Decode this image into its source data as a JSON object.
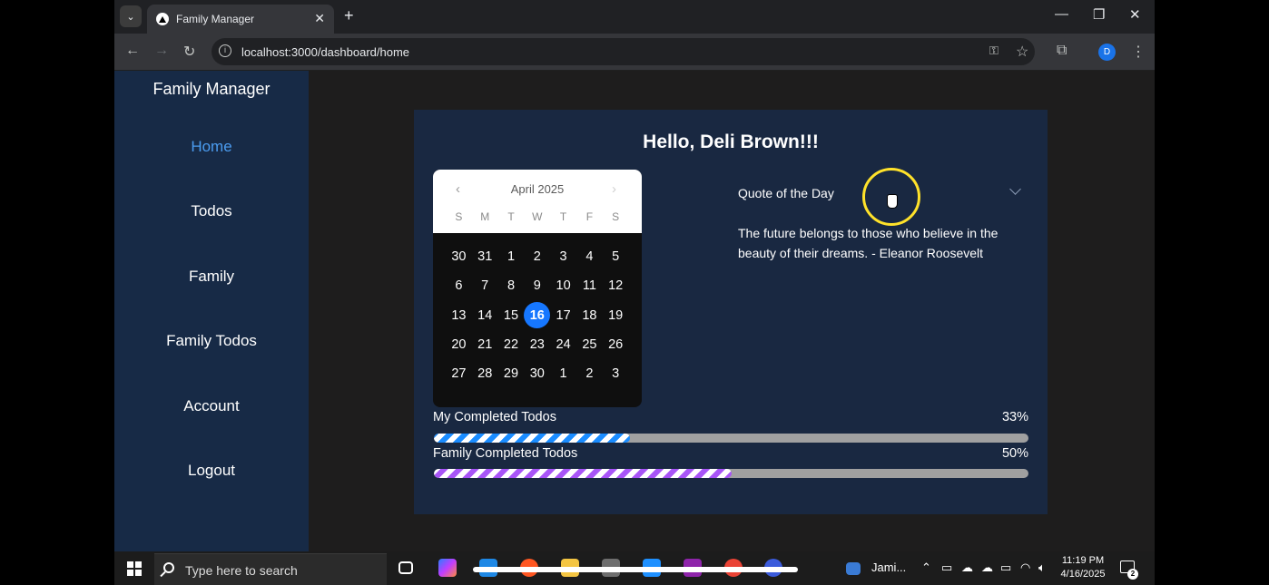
{
  "browser": {
    "tab_title": "Family Manager",
    "url": "localhost:3000/dashboard/home",
    "profile_initial": "D"
  },
  "sidebar": {
    "brand": "Family Manager",
    "items": [
      {
        "label": "Home",
        "active": true
      },
      {
        "label": "Todos"
      },
      {
        "label": "Family"
      },
      {
        "label": "Family Todos"
      },
      {
        "label": "Account"
      },
      {
        "label": "Logout"
      }
    ]
  },
  "main": {
    "greeting": "Hello, Deli Brown!!!",
    "calendar": {
      "month_label": "April 2025",
      "weekdays": [
        "S",
        "M",
        "T",
        "W",
        "T",
        "F",
        "S"
      ],
      "days": [
        30,
        31,
        1,
        2,
        3,
        4,
        5,
        6,
        7,
        8,
        9,
        10,
        11,
        12,
        13,
        14,
        15,
        16,
        17,
        18,
        19,
        20,
        21,
        22,
        23,
        24,
        25,
        26,
        27,
        28,
        29,
        30,
        1,
        2,
        3
      ],
      "selected_day": 16
    },
    "quote": {
      "title": "Quote of the Day",
      "text": "The future belongs to those who believe in the beauty of their dreams. - Eleanor Roosevelt"
    },
    "progress": [
      {
        "label": "My Completed Todos",
        "percent_text": "33%",
        "value": 0.33,
        "color": "#1a8cff"
      },
      {
        "label": "Family Completed Todos",
        "percent_text": "50%",
        "value": 0.5,
        "color": "#a855f7"
      }
    ]
  },
  "taskbar": {
    "search_placeholder": "Type here to search",
    "app_label": "Jami...",
    "time": "11:19 PM",
    "date": "4/16/2025",
    "notification_count": "2"
  }
}
